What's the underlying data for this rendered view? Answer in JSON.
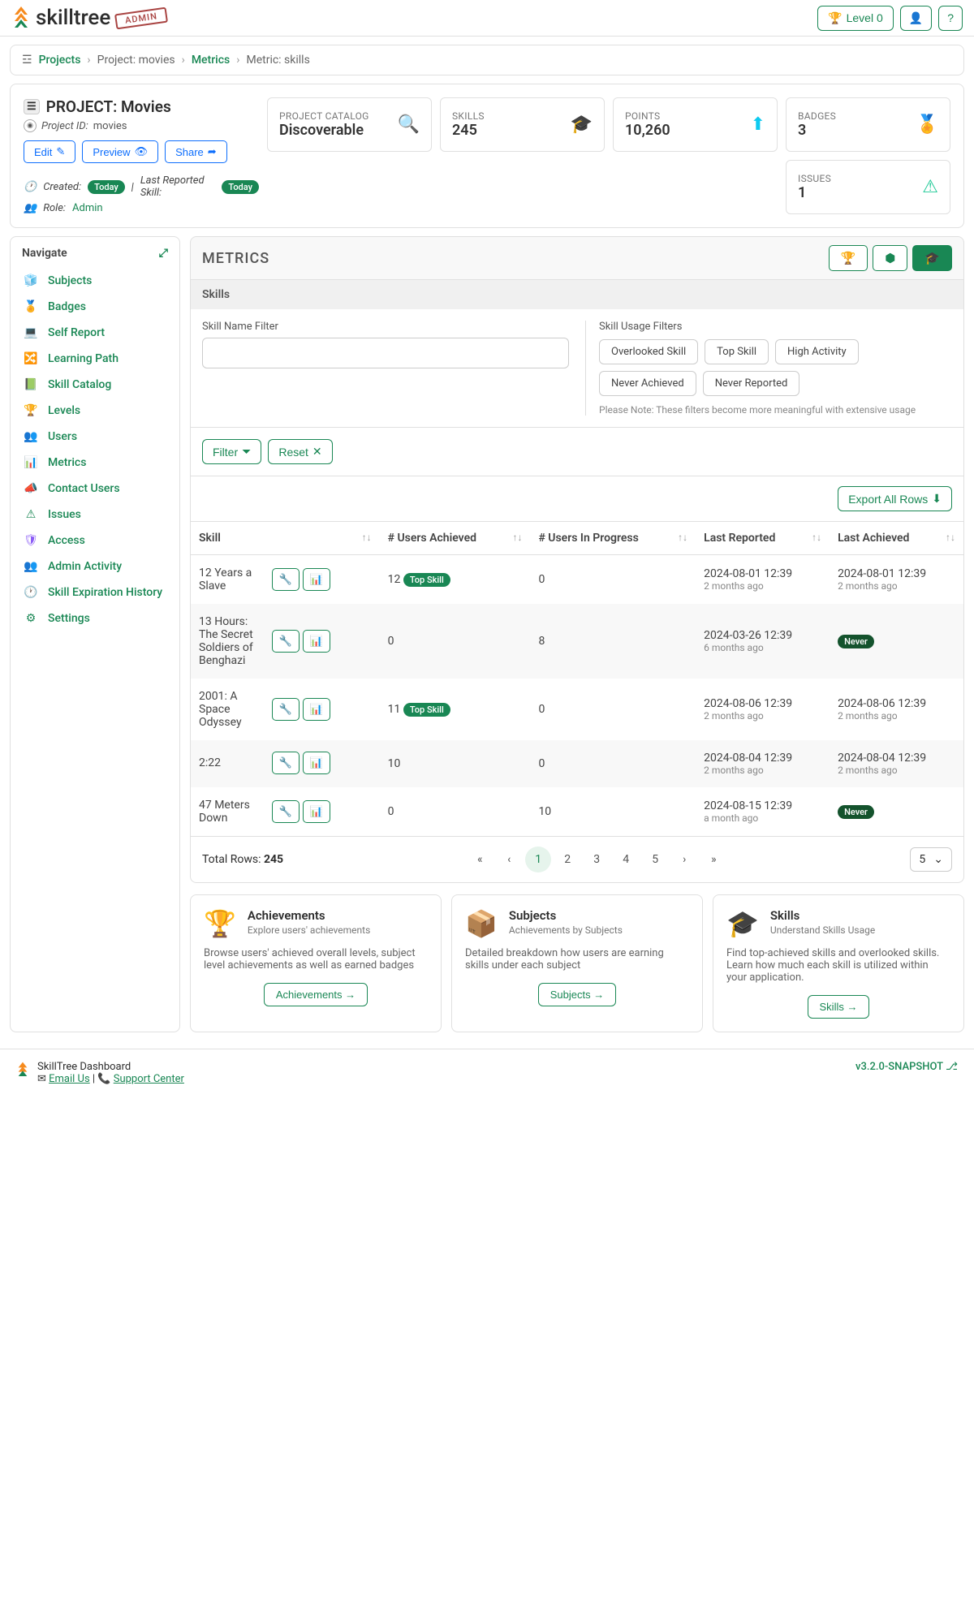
{
  "header": {
    "brand": "skilltree",
    "admin_label": "ADMIN",
    "level_label": "Level 0"
  },
  "breadcrumb": {
    "projects": "Projects",
    "project": "Project: movies",
    "metrics": "Metrics",
    "metric": "Metric: skills"
  },
  "project": {
    "title": "PROJECT: Movies",
    "project_id_label": "Project ID:",
    "project_id": "movies",
    "edit": "Edit",
    "preview": "Preview",
    "share": "Share",
    "created_label": "Created:",
    "created_val": "Today",
    "last_reported_label": "Last Reported Skill:",
    "last_reported_val": "Today",
    "role_label": "Role:",
    "role_val": "Admin"
  },
  "stats": {
    "catalog_label": "PROJECT CATALOG",
    "catalog_value": "Discoverable",
    "skills_label": "SKILLS",
    "skills_value": "245",
    "points_label": "POINTS",
    "points_value": "10,260",
    "badges_label": "BADGES",
    "badges_value": "3",
    "issues_label": "ISSUES",
    "issues_value": "1"
  },
  "sidebar": {
    "title": "Navigate",
    "items": [
      "Subjects",
      "Badges",
      "Self Report",
      "Learning Path",
      "Skill Catalog",
      "Levels",
      "Users",
      "Metrics",
      "Contact Users",
      "Issues",
      "Access",
      "Admin Activity",
      "Skill Expiration History",
      "Settings"
    ]
  },
  "metrics": {
    "heading": "METRICS",
    "section": "Skills",
    "name_filter_label": "Skill Name Filter",
    "usage_label": "Skill Usage Filters",
    "chips": [
      "Overlooked Skill",
      "Top Skill",
      "High Activity",
      "Never Achieved",
      "Never Reported"
    ],
    "note": "Please Note: These filters become more meaningful with extensive usage",
    "filter_btn": "Filter",
    "reset_btn": "Reset",
    "export_btn": "Export All Rows",
    "columns": {
      "skill": "Skill",
      "achieved": "# Users Achieved",
      "progress": "# Users In Progress",
      "reported": "Last Reported",
      "last_achieved": "Last Achieved"
    },
    "rows": [
      {
        "skill": "12 Years a Slave",
        "ach": "12",
        "ach_badge": "Top Skill",
        "prog": "0",
        "rep": "2024-08-01 12:39",
        "rep_rel": "2 months ago",
        "la": "2024-08-01 12:39",
        "la_rel": "2 months ago"
      },
      {
        "skill": "13 Hours: The Secret Soldiers of Benghazi",
        "ach": "0",
        "prog": "8",
        "rep": "2024-03-26 12:39",
        "rep_rel": "6 months ago",
        "la_badge": "Never"
      },
      {
        "skill": "2001: A Space Odyssey",
        "ach": "11",
        "ach_badge": "Top Skill",
        "prog": "0",
        "rep": "2024-08-06 12:39",
        "rep_rel": "2 months ago",
        "la": "2024-08-06 12:39",
        "la_rel": "2 months ago"
      },
      {
        "skill": "2:22",
        "ach": "10",
        "prog": "0",
        "rep": "2024-08-04 12:39",
        "rep_rel": "2 months ago",
        "la": "2024-08-04 12:39",
        "la_rel": "2 months ago"
      },
      {
        "skill": "47 Meters Down",
        "ach": "0",
        "prog": "10",
        "rep": "2024-08-15 12:39",
        "rep_rel": "a month ago",
        "la_badge": "Never"
      }
    ],
    "total_label": "Total Rows: ",
    "total_value": "245",
    "pages": [
      "1",
      "2",
      "3",
      "4",
      "5"
    ],
    "page_size": "5"
  },
  "cards": [
    {
      "title": "Achievements",
      "sub": "Explore users' achievements",
      "body": "Browse users' achieved overall levels, subject level achievements as well as earned badges",
      "btn": "Achievements"
    },
    {
      "title": "Subjects",
      "sub": "Achievements by Subjects",
      "body": "Detailed breakdown how users are earning skills under each subject",
      "btn": "Subjects"
    },
    {
      "title": "Skills",
      "sub": "Understand Skills Usage",
      "body": "Find top-achieved skills and overlooked skills. Learn how much each skill is utilized within your application.",
      "btn": "Skills"
    }
  ],
  "footer": {
    "title": "SkillTree Dashboard",
    "email": "Email Us",
    "support": "Support Center",
    "version": "v3.2.0-SNAPSHOT"
  }
}
